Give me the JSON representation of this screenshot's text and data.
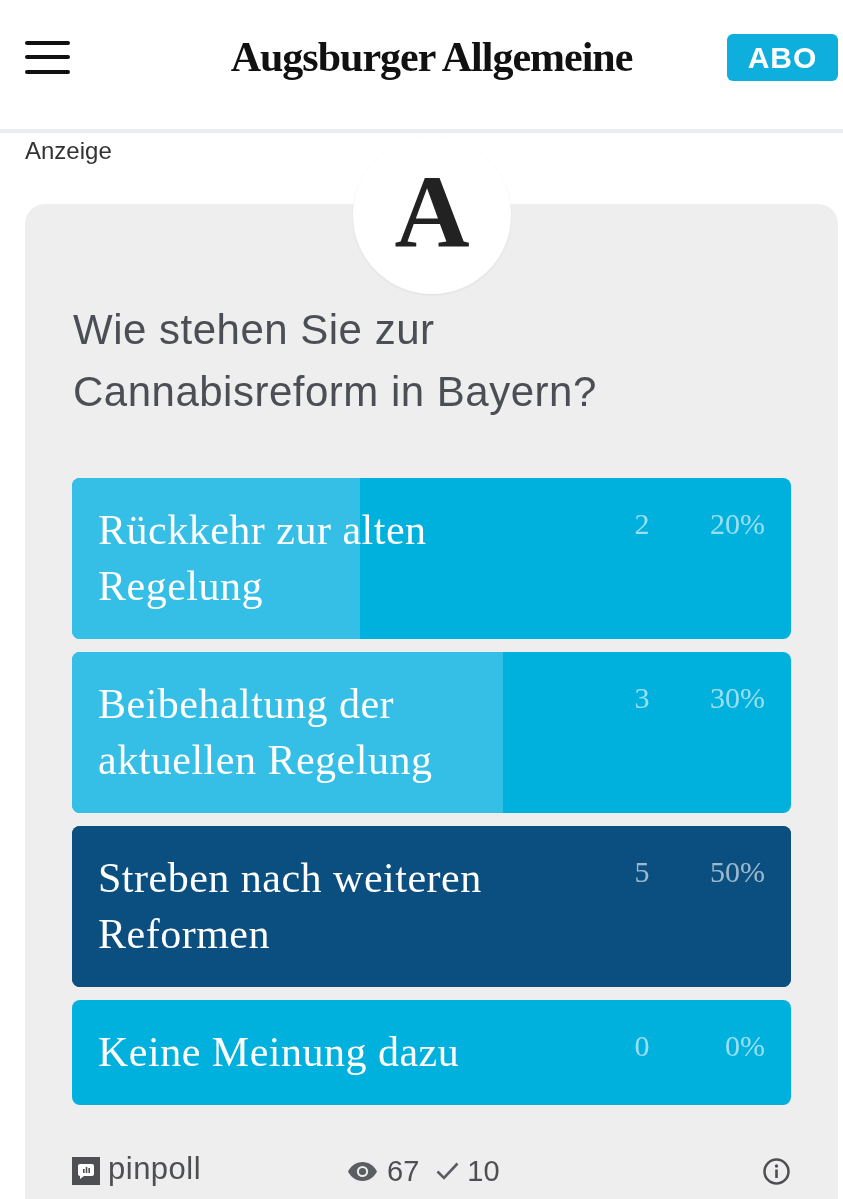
{
  "header": {
    "title": "Augsburger Allgemeine",
    "subscribe_button": "ABO"
  },
  "ad_label": "Anzeige",
  "poll": {
    "logo_letter": "A",
    "question": "Wie stehen Sie zur Cannabisreform in Bayern?",
    "options": [
      {
        "label": "Rückkehr zur alten Regelung",
        "votes": "2",
        "percent": "20%",
        "level": 0.4,
        "leading": false
      },
      {
        "label": "Beibehaltung der aktuellen Regelung",
        "votes": "3",
        "percent": "30%",
        "level": 0.6,
        "leading": false
      },
      {
        "label": "Streben nach weiteren Reformen",
        "votes": "5",
        "percent": "50%",
        "level": 1,
        "leading": true
      },
      {
        "label": "Keine Meinung dazu",
        "votes": "0",
        "percent": "0%",
        "level": 0,
        "leading": false
      }
    ],
    "footer": {
      "brand": "pinpoll",
      "views": "67",
      "votes": "10"
    }
  }
}
